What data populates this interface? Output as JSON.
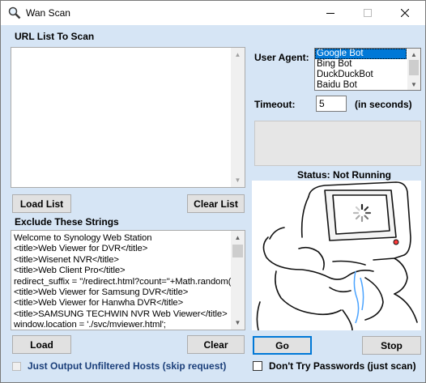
{
  "window": {
    "title": "Wan Scan",
    "icon": "magnifier-icon"
  },
  "url_list": {
    "label": "URL List To Scan",
    "value": ""
  },
  "buttons": {
    "load_list": "Load List",
    "clear_list": "Clear List",
    "load": "Load",
    "clear": "Clear",
    "go": "Go",
    "stop": "Stop"
  },
  "exclude": {
    "label": "Exclude These Strings",
    "lines": [
      "Welcome to Synology Web Station",
      "<title>Web Viewer for DVR</title>",
      "<title>Wisenet NVR</title>",
      "<title>Web Client Pro</title>",
      "redirect_suffix = \"/redirect.html?count=\"+Math.random();",
      "<title>Web Viewer for Samsung DVR</title>",
      "<title>Web Viewer for Hanwha DVR</title>",
      "<title>SAMSUNG TECHWIN NVR Web Viewer</title>",
      "window.location = './svc/mviewer.html';"
    ]
  },
  "user_agent": {
    "label": "User Agent:",
    "options": [
      "Google Bot",
      "Bing Bot",
      "DuckDuckBot",
      "Baidu Bot"
    ],
    "selected": "Google Bot"
  },
  "timeout": {
    "label": "Timeout:",
    "value": "5",
    "unit": "(in seconds)"
  },
  "status": {
    "text": "Status: Not Running"
  },
  "options": {
    "unfiltered": {
      "label": "Just Output Unfiltered Hosts (skip request)",
      "checked": false,
      "enabled": false
    },
    "no_passwords": {
      "label": "Don't Try Passwords (just scan)",
      "checked": false,
      "enabled": true
    }
  },
  "colors": {
    "window_bg": "#d6e5f5",
    "accent": "#0078d7",
    "disabled_text": "#1b3f7a"
  }
}
